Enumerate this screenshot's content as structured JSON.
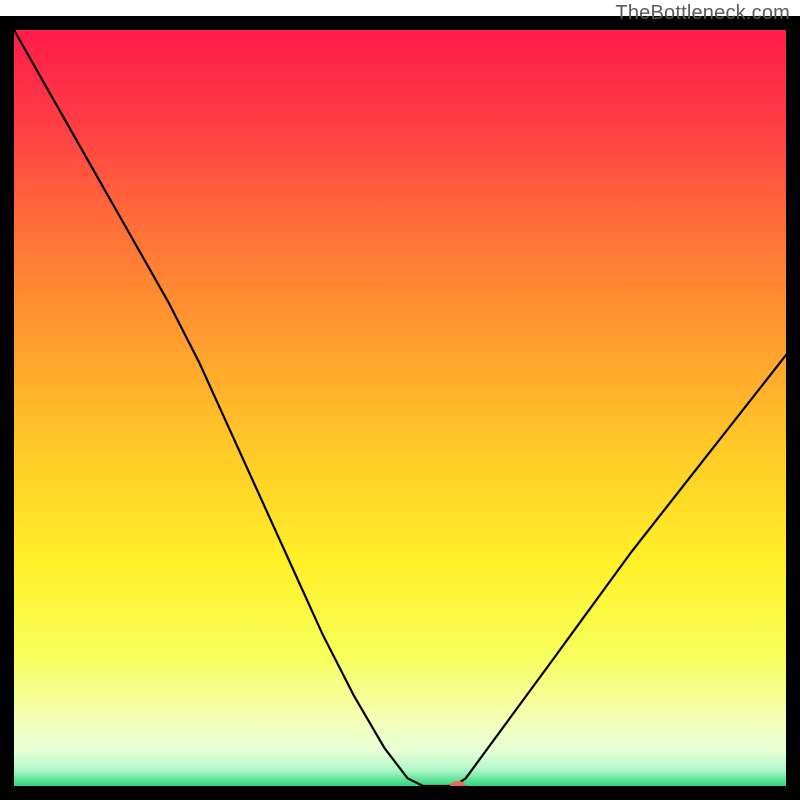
{
  "watermark": "TheBottleneck.com",
  "chart_data": {
    "type": "line",
    "title": "",
    "xlabel": "",
    "ylabel": "",
    "xlim": [
      0,
      100
    ],
    "ylim": [
      0,
      100
    ],
    "x": [
      0,
      5,
      10,
      15,
      20,
      24,
      28,
      32,
      36,
      40,
      44,
      48,
      51,
      53,
      55,
      57,
      58.5,
      70,
      80,
      90,
      100
    ],
    "values": [
      100,
      91,
      82,
      73,
      64,
      56,
      47,
      38,
      29,
      20,
      12,
      5,
      1,
      0,
      0,
      0,
      1,
      17,
      31,
      44,
      57
    ],
    "series": [
      {
        "name": "bottleneck-curve",
        "x": [
          0,
          5,
          10,
          15,
          20,
          24,
          28,
          32,
          36,
          40,
          44,
          48,
          51,
          53,
          55,
          57,
          58.5,
          70,
          80,
          90,
          100
        ],
        "values": [
          100,
          91,
          82,
          73,
          64,
          56,
          47,
          38,
          29,
          20,
          12,
          5,
          1,
          0,
          0,
          0,
          1,
          17,
          31,
          44,
          57
        ]
      }
    ],
    "marker": {
      "x": 57.5,
      "y": 0
    },
    "gradient_stops": [
      {
        "offset": 0.0,
        "color": "#ff1a4b"
      },
      {
        "offset": 0.12,
        "color": "#ff3a45"
      },
      {
        "offset": 0.25,
        "color": "#ff6a3a"
      },
      {
        "offset": 0.4,
        "color": "#ff9a2e"
      },
      {
        "offset": 0.55,
        "color": "#ffc928"
      },
      {
        "offset": 0.7,
        "color": "#fff028"
      },
      {
        "offset": 0.82,
        "color": "#f8ff5a"
      },
      {
        "offset": 0.9,
        "color": "#f3ffb0"
      },
      {
        "offset": 0.945,
        "color": "#e8ffd8"
      },
      {
        "offset": 0.97,
        "color": "#b0f8c8"
      },
      {
        "offset": 0.985,
        "color": "#50e090"
      },
      {
        "offset": 1.0,
        "color": "#00c070"
      }
    ],
    "border_color": "#000000",
    "border_width": 14,
    "line_color": "#000000",
    "line_width": 2.2,
    "marker_color": "#e86a5a",
    "marker_rx": 8,
    "marker_ry": 5
  }
}
